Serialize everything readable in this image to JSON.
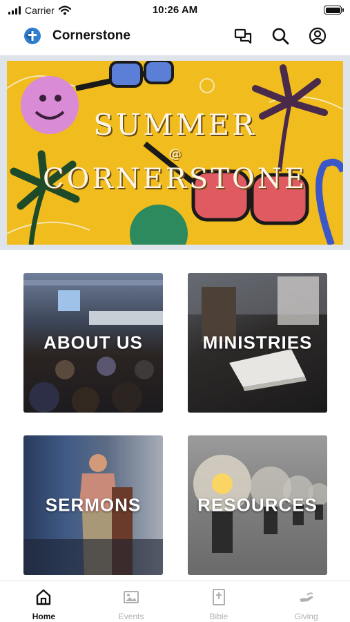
{
  "status_bar": {
    "carrier": "Carrier",
    "time": "10:26 AM",
    "icons": [
      "signal-icon",
      "wifi-icon",
      "battery-icon"
    ]
  },
  "header": {
    "title": "Cornerstone",
    "icons": [
      "logo-icon",
      "chat-icon",
      "search-icon",
      "profile-icon"
    ]
  },
  "hero": {
    "line1": "SUMMER",
    "line2": "@",
    "line3": "CORNERSTONE",
    "accent_color": "#f0bc1e"
  },
  "tiles": [
    {
      "label": "ABOUT US"
    },
    {
      "label": "MINISTRIES"
    },
    {
      "label": "SERMONS"
    },
    {
      "label": "RESOURCES"
    }
  ],
  "bottom_nav": {
    "items": [
      {
        "label": "Home",
        "icon": "home-icon",
        "active": true
      },
      {
        "label": "Events",
        "icon": "image-icon",
        "active": false
      },
      {
        "label": "Bible",
        "icon": "bible-icon",
        "active": false
      },
      {
        "label": "Giving",
        "icon": "giving-hand-icon",
        "active": false
      }
    ],
    "active_color": "#111111",
    "inactive_color": "#b0b0b0"
  }
}
